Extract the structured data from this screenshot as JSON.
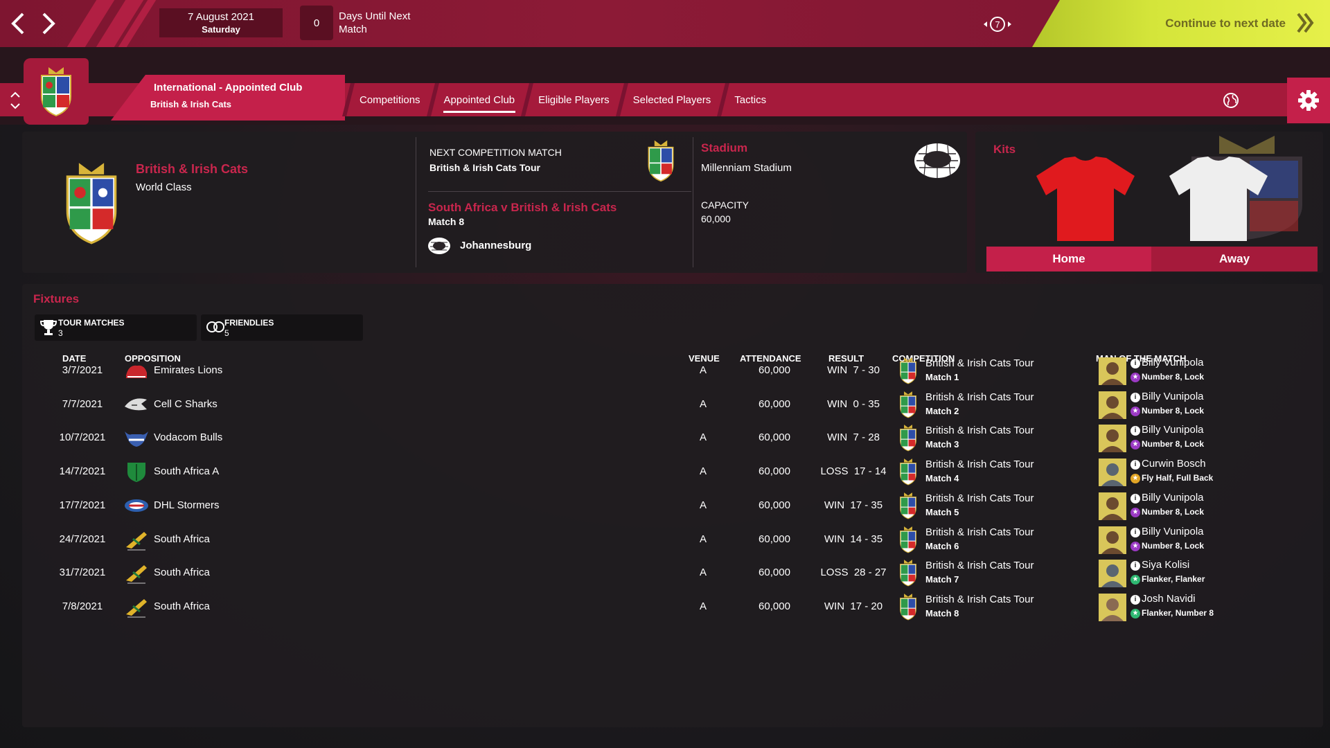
{
  "topbar": {
    "date": "7 August 2021",
    "weekday": "Saturday",
    "days_count": "0",
    "days_label": "Days Until Next Match",
    "help_badge": "7",
    "continue_label": "Continue to next date"
  },
  "header": {
    "title": "International - Appointed Club",
    "subtitle": "British & Irish Cats",
    "tabs": [
      {
        "label": "Competitions"
      },
      {
        "label": "Appointed Club",
        "active": true
      },
      {
        "label": "Eligible Players"
      },
      {
        "label": "Selected Players"
      },
      {
        "label": "Tactics"
      }
    ]
  },
  "club": {
    "name": "British & Irish Cats",
    "reputation": "World Class"
  },
  "next_match": {
    "label": "NEXT COMPETITION MATCH",
    "competition": "British & Irish Cats Tour",
    "title": "South Africa v British & Irish Cats",
    "match_no": "Match 8",
    "venue": "Johannesburg"
  },
  "stadium": {
    "heading": "Stadium",
    "name": "Millenniam Stadium",
    "capacity_label": "CAPACITY",
    "capacity": "60,000"
  },
  "kits": {
    "heading": "Kits",
    "home_label": "Home",
    "away_label": "Away",
    "home_color": "#e01a1e",
    "away_color": "#eeeeee"
  },
  "fixtures": {
    "heading": "Fixtures",
    "tour_label": "TOUR MATCHES",
    "tour_count": "3",
    "friendly_label": "FRIENDLIES",
    "friendly_count": "5",
    "columns": {
      "date": "DATE",
      "opposition": "OPPOSITION",
      "venue": "VENUE",
      "attendance": "ATTENDANCE",
      "result": "RESULT",
      "competition": "COMPETITION",
      "motm": "MAN OF THE MATCH"
    },
    "rows": [
      {
        "date": "3/7/2021",
        "opposition": "Emirates Lions",
        "venue": "A",
        "attendance": "60,000",
        "result": "WIN  7 - 30",
        "comp": "British & Irish Cats Tour",
        "match": "Match 1",
        "motm": "Billy Vunipola",
        "pos": "Number 8, Lock",
        "logo": "lion-icon",
        "photo": "#6b4a2f",
        "star": "#9b3ac4"
      },
      {
        "date": "7/7/2021",
        "opposition": "Cell C Sharks",
        "venue": "A",
        "attendance": "60,000",
        "result": "WIN  0 - 35",
        "comp": "British & Irish Cats Tour",
        "match": "Match 2",
        "motm": "Billy Vunipola",
        "pos": "Number 8, Lock",
        "logo": "shark-icon",
        "photo": "#6b4a2f",
        "star": "#9b3ac4"
      },
      {
        "date": "10/7/2021",
        "opposition": "Vodacom Bulls",
        "venue": "A",
        "attendance": "60,000",
        "result": "WIN  7 - 28",
        "comp": "British & Irish Cats Tour",
        "match": "Match 3",
        "motm": "Billy Vunipola",
        "pos": "Number 8, Lock",
        "logo": "bull-icon",
        "photo": "#6b4a2f",
        "star": "#9b3ac4"
      },
      {
        "date": "14/7/2021",
        "opposition": "South Africa A",
        "venue": "A",
        "attendance": "60,000",
        "result": "LOSS  17 - 14",
        "comp": "British & Irish Cats Tour",
        "match": "Match 4",
        "motm": "Curwin Bosch",
        "pos": "Fly Half, Full Back",
        "logo": "shield-icon",
        "photo": "#5a6570",
        "star": "#e2a526"
      },
      {
        "date": "17/7/2021",
        "opposition": "DHL Stormers",
        "venue": "A",
        "attendance": "60,000",
        "result": "WIN  17 - 35",
        "comp": "British & Irish Cats Tour",
        "match": "Match 5",
        "motm": "Billy Vunipola",
        "pos": "Number 8, Lock",
        "logo": "stormers-icon",
        "photo": "#6b4a2f",
        "star": "#9b3ac4"
      },
      {
        "date": "24/7/2021",
        "opposition": "South Africa",
        "venue": "A",
        "attendance": "60,000",
        "result": "WIN  14 - 35",
        "comp": "British & Irish Cats Tour",
        "match": "Match 6",
        "motm": "Billy Vunipola",
        "pos": "Number 8, Lock",
        "logo": "springbok-icon",
        "photo": "#6b4a2f",
        "star": "#9b3ac4"
      },
      {
        "date": "31/7/2021",
        "opposition": "South Africa",
        "venue": "A",
        "attendance": "60,000",
        "result": "LOSS  28 - 27",
        "comp": "British & Irish Cats Tour",
        "match": "Match 7",
        "motm": "Siya Kolisi",
        "pos": "Flanker, Flanker",
        "logo": "springbok-icon",
        "photo": "#5a6570",
        "star": "#2eb872"
      },
      {
        "date": "7/8/2021",
        "opposition": "South Africa",
        "venue": "A",
        "attendance": "60,000",
        "result": "WIN  17 - 20",
        "comp": "British & Irish Cats Tour",
        "match": "Match 8",
        "motm": "Josh Navidi",
        "pos": "Flanker, Number 8",
        "logo": "springbok-icon",
        "photo": "#8a6a52",
        "star": "#2eb872"
      }
    ]
  }
}
